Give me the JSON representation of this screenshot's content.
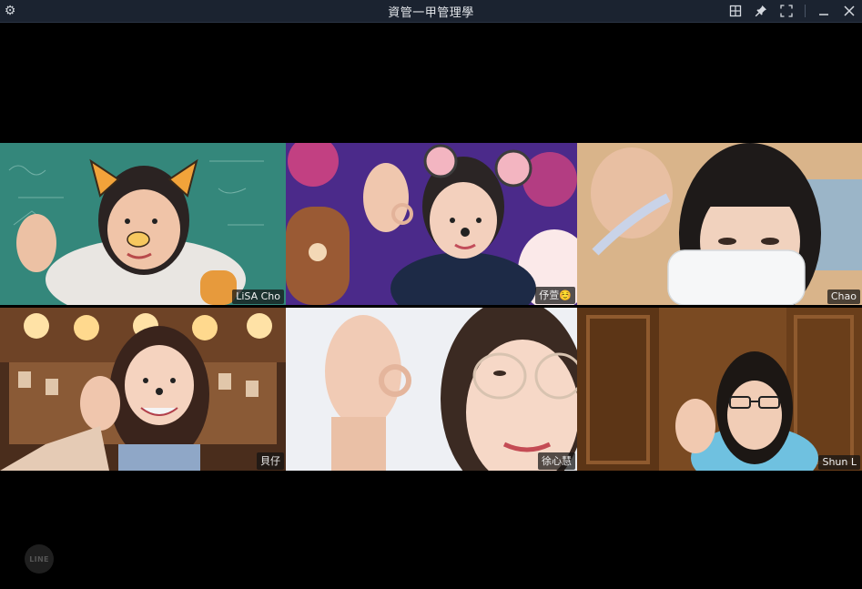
{
  "window": {
    "title": "資管一甲管理學"
  },
  "icons": {
    "settings": "gear-icon",
    "layout": "grid-layout-icon",
    "pin": "pin-icon",
    "fullscreen": "fullscreen-icon",
    "minimize": "minimize-icon",
    "close": "close-icon"
  },
  "participants": [
    {
      "name": "LiSA Cho"
    },
    {
      "name": "伃萱☺️"
    },
    {
      "name": "Chao"
    },
    {
      "name": "貝仔"
    },
    {
      "name": "徐心慧"
    },
    {
      "name": "Shun L"
    }
  ],
  "brand": {
    "logo_text": "LINE"
  },
  "colors": {
    "titlebar": "#1b2330",
    "background": "#000000"
  }
}
